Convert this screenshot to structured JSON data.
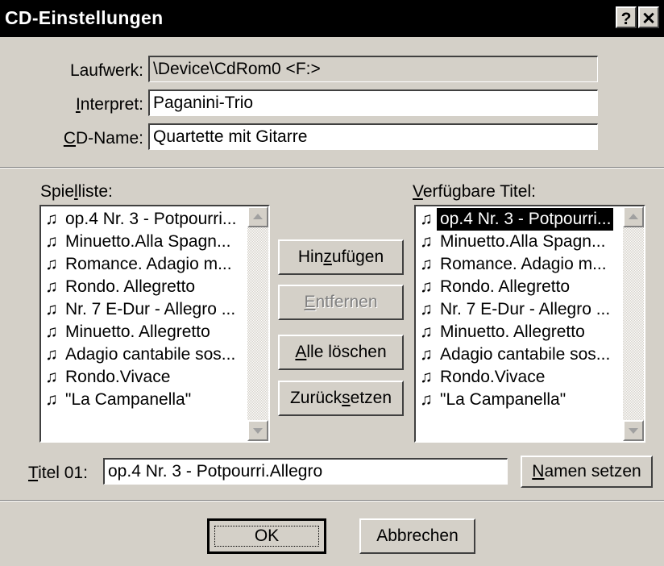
{
  "window": {
    "title": "CD-Einstellungen",
    "help_label": "?",
    "close_label": "✕"
  },
  "fields": {
    "drive": {
      "label": "Laufwerk:",
      "value": "\\Device\\CdRom0  <F:>"
    },
    "artist": {
      "label_mnemonic": "I",
      "label_rest": "nterpret:",
      "value": "Paganini-Trio"
    },
    "cd_name": {
      "label_mnemonic": "C",
      "label_rest": "D-Name:",
      "value": "Quartette mit Gitarre"
    }
  },
  "playlist": {
    "label_pre": "Spie",
    "label_mnemonic": "l",
    "label_post": "liste:",
    "note_icon": "♫",
    "items": [
      "op.4 Nr. 3 - Potpourri...",
      "Minuetto.Alla Spagn...",
      "Romance. Adagio m...",
      "Rondo. Allegretto",
      "Nr. 7 E-Dur - Allegro ...",
      "Minuetto. Allegretto",
      "Adagio cantabile sos...",
      "Rondo.Vivace",
      "\"La Campanella\""
    ]
  },
  "available": {
    "label_mnemonic": "V",
    "label_rest": "erfügbare Titel:",
    "note_icon": "♫",
    "selected_index": 0,
    "items": [
      "op.4 Nr. 3 - Potpourri...",
      "Minuetto.Alla Spagn...",
      "Romance. Adagio m...",
      "Rondo. Allegretto",
      "Nr. 7 E-Dur - Allegro ...",
      "Minuetto. Allegretto",
      "Adagio cantabile sos...",
      "Rondo.Vivace",
      "\"La Campanella\""
    ]
  },
  "buttons": {
    "add": {
      "pre": "Hin",
      "mnemonic": "z",
      "post": "ufügen"
    },
    "remove": {
      "pre": "",
      "mnemonic": "E",
      "post": "ntfernen"
    },
    "clear_all": {
      "pre": "",
      "mnemonic": "A",
      "post": "lle löschen"
    },
    "reset": {
      "pre": "Zurück",
      "mnemonic": "s",
      "post": "etzen"
    },
    "set_name": {
      "pre": "",
      "mnemonic": "N",
      "post": "amen setzen"
    },
    "ok": "OK",
    "cancel": "Abbrechen"
  },
  "title_field": {
    "label_mnemonic": "T",
    "label_rest": "itel 01:",
    "value": "op.4 Nr. 3 - Potpourri.Allegro"
  },
  "scroll_icons": {
    "up": "scroll-up-arrow",
    "down": "scroll-down-arrow"
  }
}
